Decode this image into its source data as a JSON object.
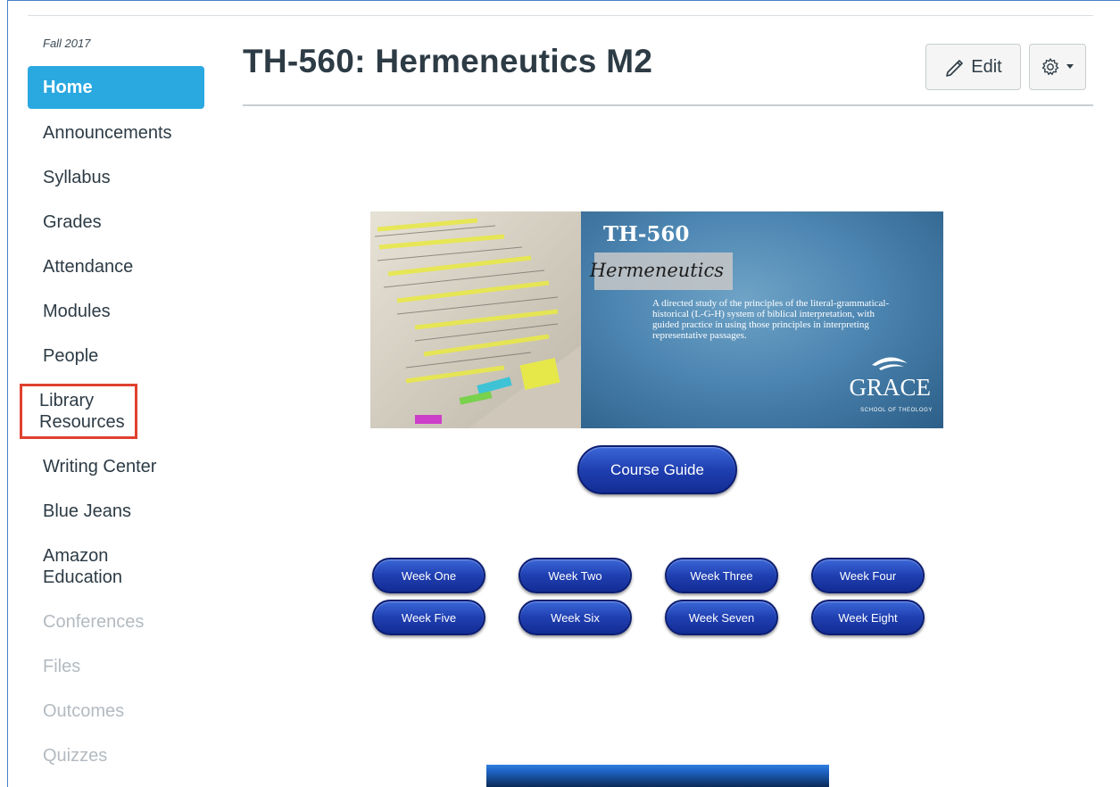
{
  "sidebar": {
    "term": "Fall 2017",
    "items": [
      {
        "label": "Home"
      },
      {
        "label": "Announcements"
      },
      {
        "label": "Syllabus"
      },
      {
        "label": "Grades"
      },
      {
        "label": "Attendance"
      },
      {
        "label": "Modules"
      },
      {
        "label": "People"
      },
      {
        "label": "Library\nResources"
      },
      {
        "label": "Writing Center"
      },
      {
        "label": "Blue Jeans"
      },
      {
        "label": "Amazon\nEducation"
      },
      {
        "label": "Conferences"
      },
      {
        "label": "Files"
      },
      {
        "label": "Outcomes"
      },
      {
        "label": "Quizzes"
      }
    ]
  },
  "header": {
    "title": "TH-560: Hermeneutics M2",
    "edit_label": "Edit",
    "edit_icon": "pencil-icon",
    "settings_icon": "gear-icon"
  },
  "banner": {
    "code": "TH-560",
    "subtitle": "Hermeneutics",
    "description": "A directed study of the principles of the literal-grammatical-historical (L-G-H) system of biblical interpretation, with guided practice in using those principles in interpreting representative passages.",
    "logo": "GRACE",
    "logo_sub": "SCHOOL OF THEOLOGY"
  },
  "course_guide_label": "Course Guide",
  "weeks": [
    "Week One",
    "Week Two",
    "Week Three",
    "Week Four",
    "Week Five",
    "Week Six",
    "Week Seven",
    "Week Eight"
  ],
  "colors": {
    "active_nav": "#2aa8e0",
    "highlight_box": "#e0412f",
    "pill_blue": "#1f3fb1",
    "disabled_text": "#b3bac0"
  }
}
